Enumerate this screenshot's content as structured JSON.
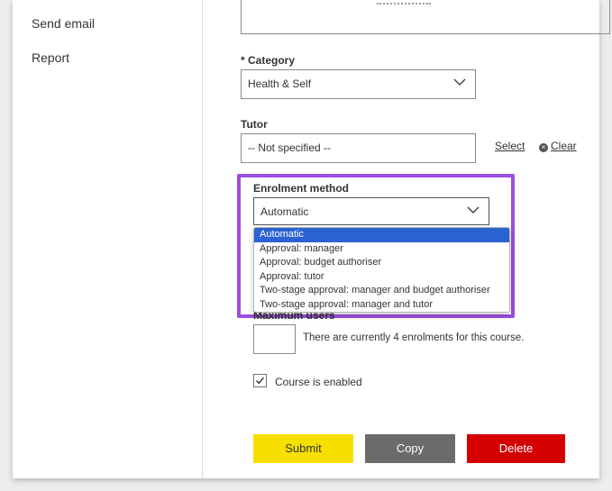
{
  "sidebar": {
    "items": [
      {
        "label": "Send email"
      },
      {
        "label": "Report"
      }
    ]
  },
  "form": {
    "category": {
      "label": "* Category",
      "value": "Health & Self"
    },
    "tutor": {
      "label": "Tutor",
      "value": "-- Not specified --",
      "select_label": "Select",
      "clear_label": "Clear"
    },
    "enrolment": {
      "label": "Enrolment method",
      "value": "Automatic",
      "options": [
        "Automatic",
        "Approval: manager",
        "Approval: budget authoriser",
        "Approval: tutor",
        "Two-stage approval: manager and budget authoriser",
        "Two-stage approval: manager and tutor"
      ]
    },
    "max_users": {
      "label": "Maximum users",
      "value": "",
      "help": "There are currently 4 enrolments for this course."
    },
    "enabled": {
      "label": "Course is enabled",
      "checked": true
    }
  },
  "actions": {
    "submit": "Submit",
    "copy": "Copy",
    "delete": "Delete"
  },
  "colors": {
    "highlight": "#9b4ee0",
    "selected_option": "#2a62d1",
    "submit": "#f7e000",
    "copy": "#6b6b6b",
    "delete": "#d40000"
  }
}
